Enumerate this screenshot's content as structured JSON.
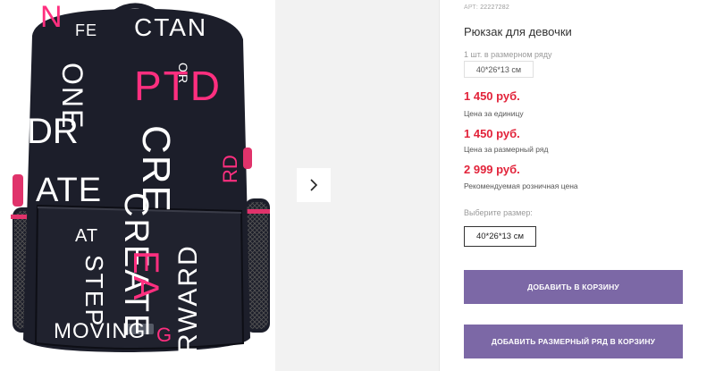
{
  "product": {
    "article_prefix": "АРТ:",
    "article_number": "22227282",
    "title": "Рюкзак для девочки",
    "pack_hint": "1 шт. в размерном ряду",
    "pack_size": "40*26*13 см"
  },
  "prices": [
    {
      "value": "1 450 руб.",
      "label": "Цена за единицу"
    },
    {
      "value": "1 450 руб.",
      "label": "Цена за размерный ряд"
    },
    {
      "value": "2 999 руб.",
      "label": "Рекомендуемая розничная цена"
    }
  ],
  "size_select": {
    "label": "Выберите размер:",
    "selected": "40*26*13 см"
  },
  "buttons": {
    "add_to_cart": "ДОБАВИТЬ В КОРЗИНУ",
    "add_row_to_cart": "ДОБАВИТЬ РАЗМЕРНЫЙ РЯД В КОРЗИНУ"
  },
  "product_image": {
    "print_words": [
      "ONE",
      "PTD",
      "CRE",
      "CREATE",
      "STEP",
      "MOVING",
      "RWARD",
      "ATE",
      "DR"
    ]
  },
  "colors": {
    "price": "#e2233a",
    "button": "#7c68a6",
    "backpack": "#1c1e2a",
    "print_pink": "#ff2f7f"
  },
  "icons": {
    "next": "chevron-right-icon"
  }
}
